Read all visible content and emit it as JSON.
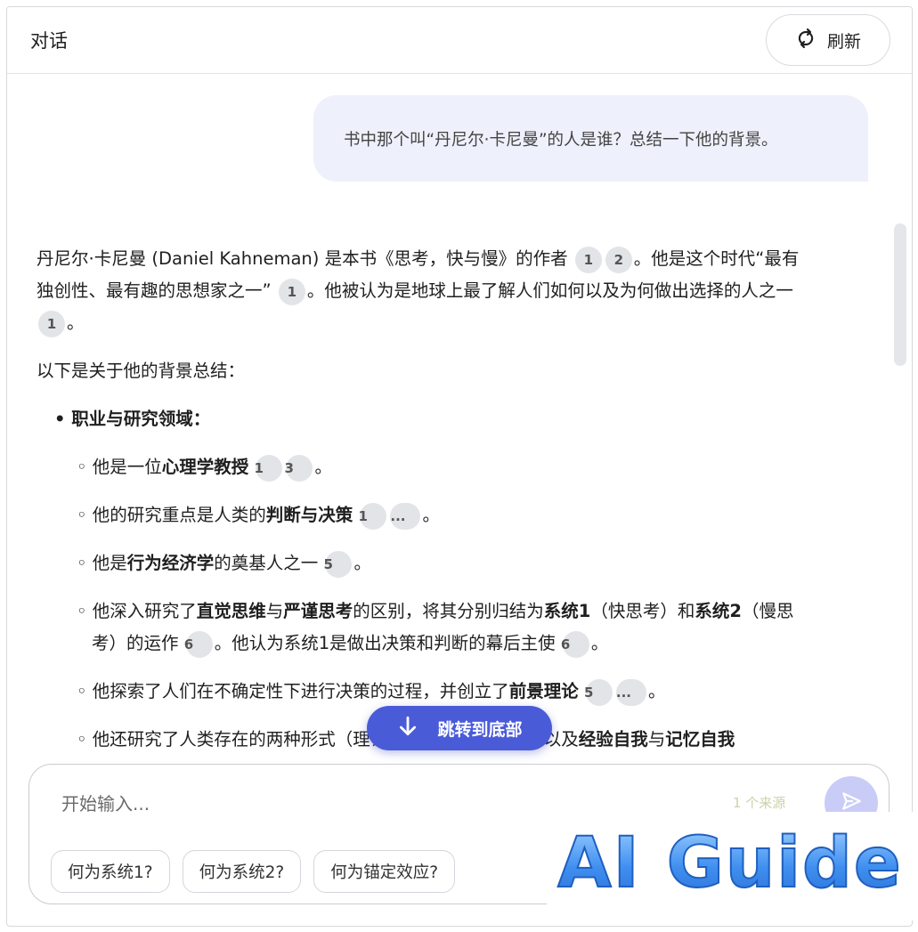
{
  "header": {
    "title": "对话",
    "refresh_label": "刷新"
  },
  "user_message": "书中那个叫“丹尼尔·卡尼曼”的人是谁？总结一下他的背景。",
  "answer": {
    "p1": {
      "t1": "丹尼尔·卡尼曼 (Daniel Kahneman) 是本书《思考，快与慢》的作者",
      "c1": "1",
      "c2": "2",
      "t2": "。他是这个时代“最有独创性、最有趣的思想家之一”",
      "c3": "1",
      "t3": "。他被认为是地球上最了解人们如何以及为何做出选择的人之一",
      "c4": "1",
      "t4": "。"
    },
    "p2": "以下是关于他的背景总结：",
    "section_title": "职业与研究领域：",
    "items": [
      {
        "a": "他是一位",
        "b": "心理学教授",
        "c1": "1",
        "c2": "3",
        "end": "。"
      },
      {
        "a": "他的研究重点是人类的",
        "b": "判断与决策",
        "c1": "1",
        "c2": "...",
        "end": "。"
      },
      {
        "a": "他是",
        "b": "行为经济学",
        "a2": "的奠基人之一",
        "c1": "5",
        "end": "。"
      },
      {
        "a": "他深入研究了",
        "b": "直觉思维",
        "a2": "与",
        "b2": "严谨思考",
        "a3": "的区别，将其分别归结为",
        "b3": "系统1",
        "a4": "（快思考）和",
        "b4": "系统2",
        "a5": "（慢思考）的运作",
        "c1": "6",
        "a6": "。他认为系统1是做出决策和判断的幕后主使",
        "c2": "6",
        "end": "。"
      },
      {
        "a": "他探索了人们在不确定性下进行决策的过程，并创立了",
        "b": "前景理论",
        "c1": "5",
        "c2": "...",
        "end": "。"
      },
      {
        "a": "他还研究了人类存在的两种形式（理论经济人与现实人类）以及",
        "b": "经验自我",
        "a2": "与",
        "b2": "记忆自我"
      }
    ]
  },
  "jump_button": "跳转到底部",
  "input": {
    "placeholder": "开始输入...",
    "source_count": "1 个来源"
  },
  "suggestions": [
    "何为系统1?",
    "何为系统2?",
    "何为锚定效应?"
  ],
  "watermark": "AI Guide",
  "colors": {
    "accent": "#4a5bd8",
    "user_bubble": "#eef0fb",
    "citation_bg": "#e3e4e8"
  }
}
